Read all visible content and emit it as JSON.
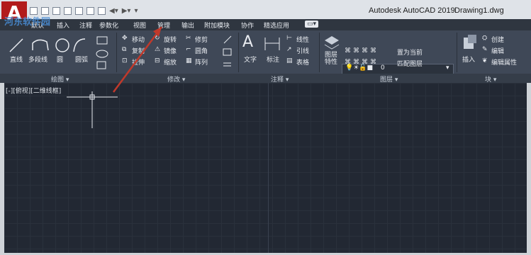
{
  "titlebar": {
    "app_name": "Autodesk AutoCAD 2019",
    "document": "Drawing1.dwg",
    "logo_letter": "A"
  },
  "tabs": [
    "默认",
    "插入",
    "注释",
    "参数化",
    "视图",
    "管理",
    "输出",
    "附加模块",
    "协作",
    "精选应用"
  ],
  "draw_panel": {
    "items": [
      "直线",
      "多段线",
      "圆",
      "圆弧"
    ],
    "label": "绘图"
  },
  "modify_panel": {
    "items": [
      "移动",
      "旋转",
      "修剪",
      "复制",
      "镜像",
      "圆角",
      "拉伸",
      "缩放",
      "阵列"
    ],
    "label": "修改"
  },
  "annotation_panel": {
    "items": [
      "文字",
      "标注",
      "线性",
      "引线",
      "表格"
    ],
    "label": "注释"
  },
  "layers_panel": {
    "layer_props": "图层\n特性",
    "layer_name": "0",
    "set_current": "置为当前",
    "match_layer": "匹配图层",
    "label": "图层"
  },
  "block_panel": {
    "insert": "插入",
    "create": "创建",
    "edit": "编辑",
    "edit_attr": "编辑属性",
    "label": "块"
  },
  "canvas": {
    "viewport_label": "[-][俯视][二维线框]"
  },
  "colors": {
    "annotation_arrow": "#c0392b",
    "logo": "#b21b1b"
  }
}
